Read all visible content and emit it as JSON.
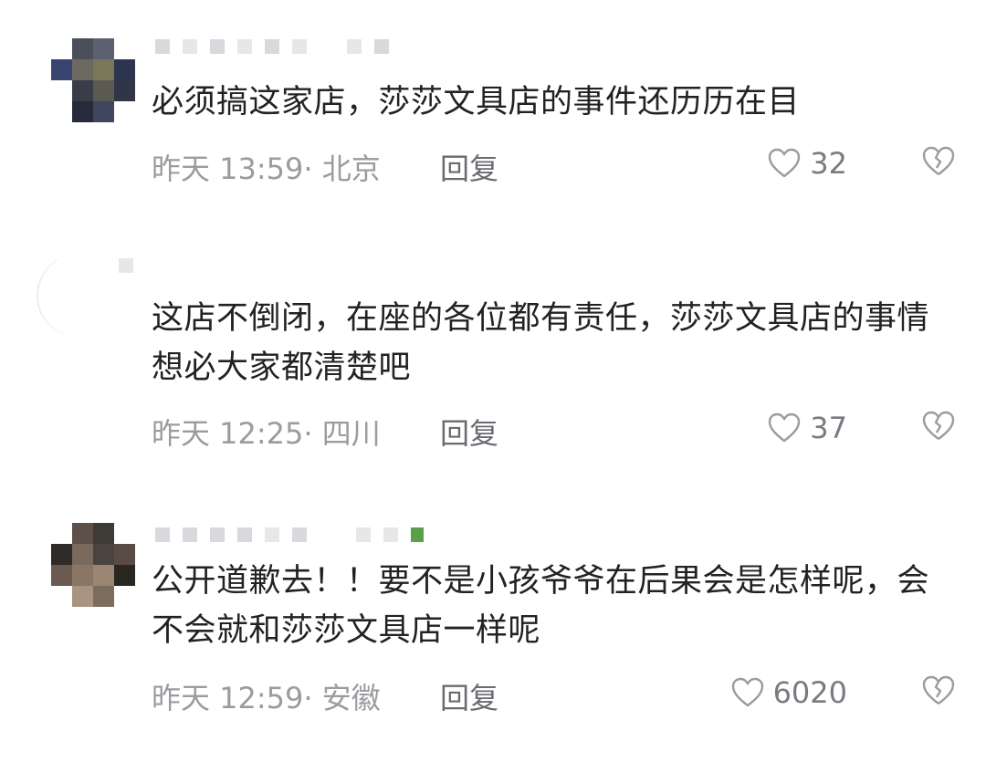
{
  "comments": [
    {
      "text": "必须搞这家店，莎莎文具店的事件还历历在目",
      "time": "昨天 13:59· 北京",
      "reply": "回复",
      "likes": "32"
    },
    {
      "text": "这店不倒闭，在座的各位都有责任，莎莎文具店的事情想必大家都清楚吧",
      "time": "昨天 12:25· 四川",
      "reply": "回复",
      "likes": "37"
    },
    {
      "text": "公开道歉去！！要不是小孩爷爷在后果会是怎样呢，会不会就和莎莎文具店一样呢",
      "time": "昨天 12:59· 安徽",
      "reply": "回复",
      "likes": "6020"
    }
  ],
  "icons": {
    "like": "heart-icon",
    "dislike": "broken-heart-icon"
  },
  "colors": {
    "text": "#222222",
    "meta": "#9b9ba0",
    "reply": "#6a6a70"
  }
}
